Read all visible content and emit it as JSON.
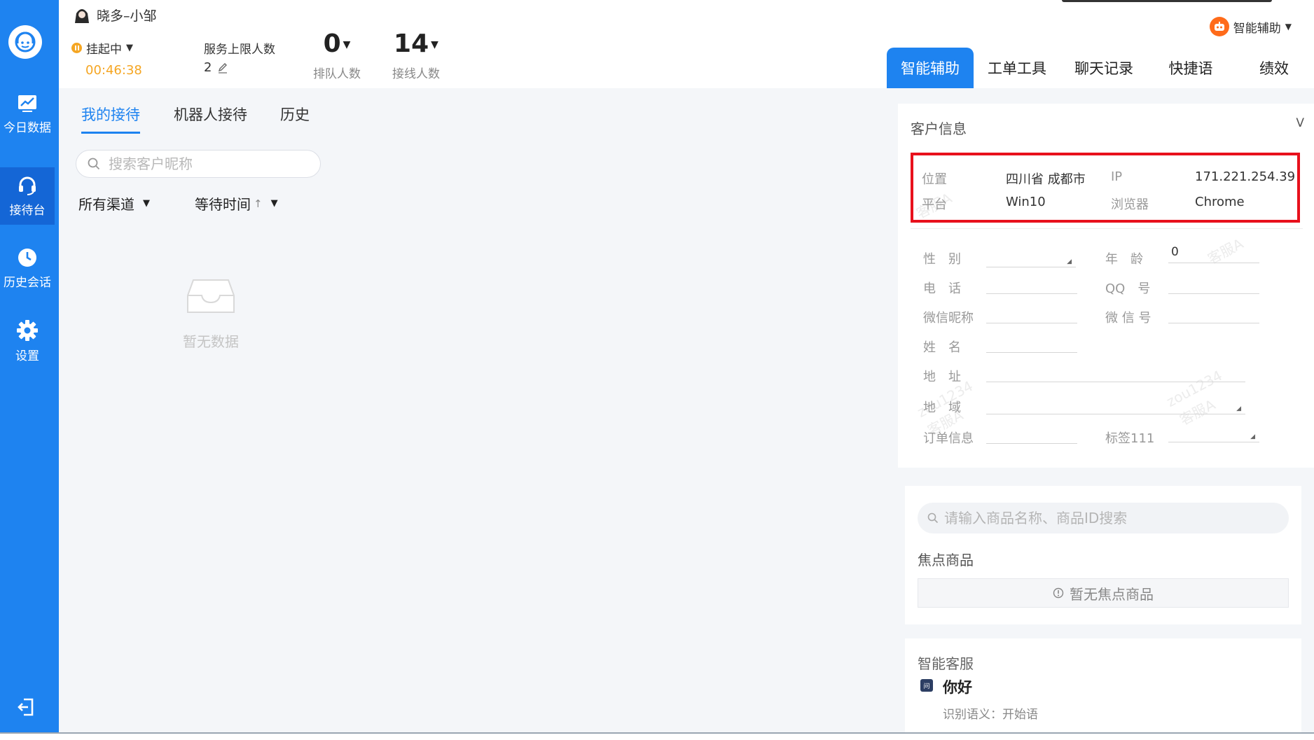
{
  "rail": {
    "items": [
      {
        "label": "今日数据",
        "icon": "chart-icon"
      },
      {
        "label": "接待台",
        "icon": "headset-icon"
      },
      {
        "label": "历史会话",
        "icon": "clock-icon"
      },
      {
        "label": "设置",
        "icon": "gear-icon"
      }
    ],
    "active": "接待台"
  },
  "header": {
    "agent_name": "晓多–小邹",
    "status": "挂起中",
    "timer": "00:46:38",
    "limit_label": "服务上限人数",
    "limit_value": "2",
    "queue_count": "0",
    "queue_label": "排队人数",
    "online_count": "14",
    "online_label": "接线人数"
  },
  "list": {
    "tabs": [
      "我的接待",
      "机器人接待",
      "历史"
    ],
    "active_tab": "我的接待",
    "search_placeholder": "搜索客户昵称",
    "channel_filter": "所有渠道",
    "sort_filter": "等待时间",
    "empty_text": "暂无数据"
  },
  "right": {
    "assist_label": "智能辅助",
    "tabs": [
      "智能辅助",
      "工单工具",
      "聊天记录",
      "快捷语",
      "绩效"
    ],
    "active_tab": "智能辅助",
    "customer": {
      "title": "客户信息",
      "collapse": "V",
      "location_label": "位置",
      "location_value": "四川省 成都市",
      "ip_label": "IP",
      "ip_value": "171.221.254.39",
      "platform_label": "平台",
      "platform_value": "Win10",
      "browser_label": "浏览器",
      "browser_value": "Chrome",
      "fields": {
        "gender": "性　别",
        "age": "年　龄",
        "age_value": "0",
        "phone": "电　话",
        "qq": "QQ　号",
        "wechat_nick": "微信昵称",
        "wechat_id": "微 信 号",
        "name": "姓　名",
        "address": "地　址",
        "region": "地　域",
        "order": "订单信息",
        "tag": "标签111"
      },
      "watermarks": [
        "客服A",
        "zou1234",
        "客服A",
        "zou1234",
        "客服A",
        "客服A"
      ]
    },
    "goods": {
      "search_placeholder": "请输入商品名称、商品ID搜索",
      "focus_title": "焦点商品",
      "no_focus": "暂无焦点商品"
    },
    "ai": {
      "title": "智能客服",
      "badge": "问",
      "question": "你好",
      "intent": "识别语义：开始语"
    }
  }
}
